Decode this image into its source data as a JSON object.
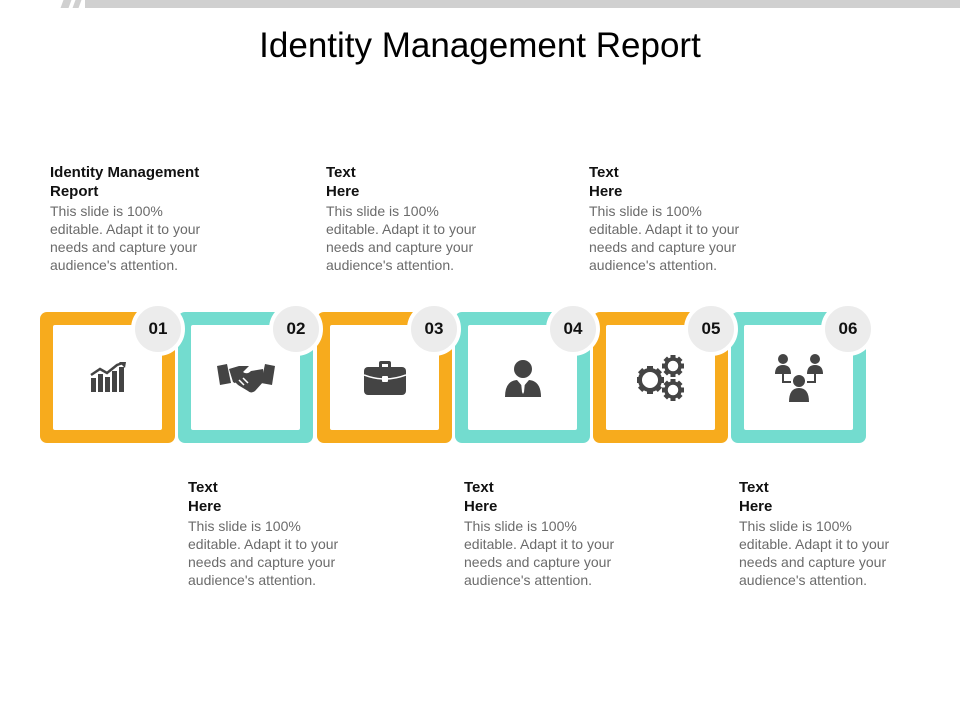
{
  "title": "Identity Management Report",
  "colors": {
    "orange": "#f7ab1d",
    "teal": "#73dccf",
    "icon": "#444444",
    "badge": "#ececec"
  },
  "steps": [
    {
      "number": "01",
      "heading": "Identity Management Report",
      "text": "This slide is 100% editable. Adapt it to your needs and capture your audience's attention.",
      "icon": "growth-chart-icon",
      "color": "orange"
    },
    {
      "number": "02",
      "heading": "Text Here",
      "text": "This slide is 100% editable. Adapt it to your needs and capture your audience's attention.",
      "icon": "handshake-icon",
      "color": "teal"
    },
    {
      "number": "03",
      "heading": "Text Here",
      "text": "This slide is 100% editable. Adapt it to your needs and capture your audience's attention.",
      "icon": "briefcase-icon",
      "color": "orange"
    },
    {
      "number": "04",
      "heading": "Text Here",
      "text": "This slide is 100% editable. Adapt it to your needs and capture your audience's attention.",
      "icon": "user-icon",
      "color": "teal"
    },
    {
      "number": "05",
      "heading": "Text Here",
      "text": "This slide is 100% editable. Adapt it to your needs and capture your audience's attention.",
      "icon": "gears-icon",
      "color": "orange"
    },
    {
      "number": "06",
      "heading": "Text Here",
      "text": "This slide is 100% editable. Adapt it to your needs and capture your audience's attention.",
      "icon": "team-network-icon",
      "color": "teal"
    }
  ]
}
